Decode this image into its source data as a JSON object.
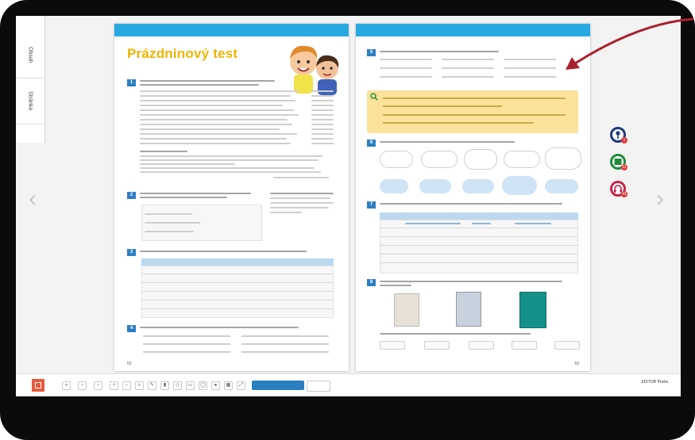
{
  "sidebar": {
    "tabs": [
      "Obsah",
      "Stránka"
    ]
  },
  "left_page": {
    "title": "Prázdninový test",
    "page_number": "52"
  },
  "right_page": {
    "page_number": "53"
  },
  "media_badges": {
    "video": "11",
    "audio": "41"
  },
  "toolbar": {
    "primary_label": "",
    "secondary_label": "",
    "brand_line1": "EDITOR Praha",
    "brand_line2": ""
  },
  "colors": {
    "header_blue": "#29a9e1",
    "title_yellow": "#f0b400",
    "section_blue": "#2d7fc4",
    "highlight_yellow": "#fbe29a",
    "annotation_red": "#a8202e",
    "audio_red": "#c8244a",
    "video_green": "#1f8a3b",
    "link_navy": "#1d3b7a"
  }
}
